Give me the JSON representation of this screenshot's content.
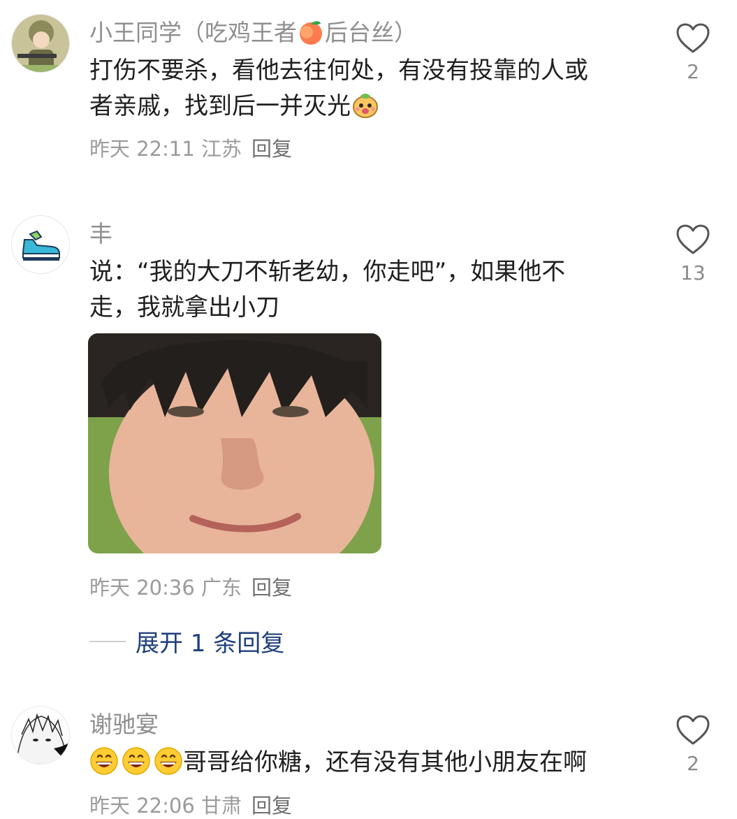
{
  "comments": [
    {
      "username": "小王同学（吃鸡王者",
      "username_tail": "后台丝）",
      "text_line1": "打伤不要杀，看他去往何处，有没有投靠的人或",
      "text_line2": "者亲戚，找到后一并灭光",
      "time": "昨天 22:11 江苏",
      "reply": "回复",
      "likes": "2"
    },
    {
      "username": "丰",
      "text_line1": "说：“我的大刀不斩老幼，你走吧”，如果他不",
      "text_line2": "走，我就拿出小刀",
      "time": "昨天 20:36 广东",
      "reply": "回复",
      "likes": "13",
      "expand_label": "展开 1 条回复"
    },
    {
      "username": "谢驰宴",
      "text": "哥哥给你糖，还有没有其他小朋友在啊",
      "time": "昨天 22:06 甘肃",
      "reply": "回复",
      "likes": "2"
    }
  ],
  "colors": {
    "username": "#8f8f8f",
    "text": "#1f1f1f",
    "meta": "#9b9b9b",
    "expand": "#1d3f7a"
  }
}
